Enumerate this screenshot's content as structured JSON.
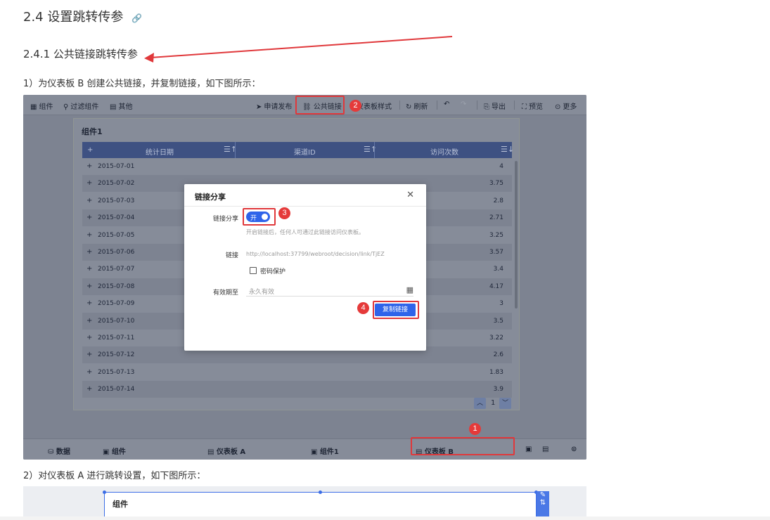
{
  "heading": {
    "title": "2.4 设置跳转传参",
    "subtitle": "2.4.1 公共链接跳转传参"
  },
  "paragraphs": {
    "step1": "1）为仪表板 B 创建公共链接，并复制链接，如下图所示：",
    "step2": "2）对仪表板 A 进行跳转设置，如下图所示："
  },
  "screenshot1": {
    "toolbar": {
      "left": [
        "组件",
        "过滤组件",
        "其他"
      ],
      "apply_publish": "申请发布",
      "public_link": "公共链接",
      "dashboard_style": "仪表板样式",
      "refresh": "刷新",
      "export": "导出",
      "preview": "预览",
      "more": "更多"
    },
    "card_title": "组件1",
    "table": {
      "columns": [
        "统计日期",
        "渠道ID",
        "访问次数"
      ],
      "rows": [
        {
          "date": "2015-07-01",
          "value": "4"
        },
        {
          "date": "2015-07-02",
          "value": "3.75"
        },
        {
          "date": "2015-07-03",
          "value": "2.8"
        },
        {
          "date": "2015-07-04",
          "value": "2.71"
        },
        {
          "date": "2015-07-05",
          "value": "3.25"
        },
        {
          "date": "2015-07-06",
          "value": "3.57"
        },
        {
          "date": "2015-07-07",
          "value": "3.4"
        },
        {
          "date": "2015-07-08",
          "value": "4.17"
        },
        {
          "date": "2015-07-09",
          "value": "3"
        },
        {
          "date": "2015-07-10",
          "value": "3.5"
        },
        {
          "date": "2015-07-11",
          "value": "3.22"
        },
        {
          "date": "2015-07-12",
          "value": "2.6"
        },
        {
          "date": "2015-07-13",
          "value": "1.83"
        },
        {
          "date": "2015-07-14",
          "value": "3.9"
        }
      ]
    },
    "pager": {
      "page": "1"
    },
    "dialog": {
      "title": "链接分享",
      "share_label": "链接分享",
      "switch_text": "开",
      "hint": "开启链接后，任何人可通过此链接访问仪表板。",
      "link_label": "链接",
      "link_value": "http://localhost:37799/webroot/decision/link/TjEZ",
      "password_label": "密码保护",
      "expire_label": "有效期至",
      "expire_placeholder": "永久有效",
      "copy_button": "复制链接"
    },
    "bottom_tabs": [
      "数据",
      "组件",
      "仪表板 A",
      "组件1",
      "仪表板 B"
    ],
    "badges": [
      "1",
      "2",
      "3",
      "4"
    ]
  },
  "screenshot2": {
    "card_title": "组件"
  },
  "colors": {
    "annotation_red": "#e0383b",
    "primary_blue": "#2f64ea",
    "table_header": "#3e5182"
  }
}
